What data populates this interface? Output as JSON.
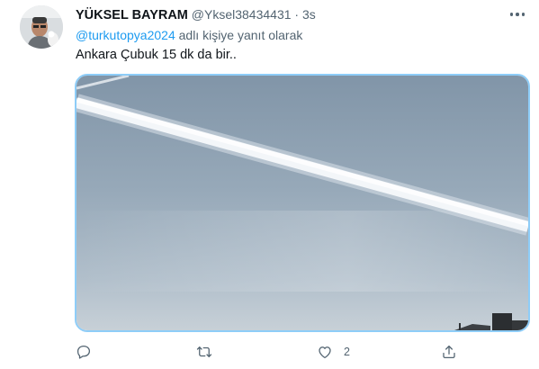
{
  "tweet": {
    "author_name": "YÜKSEL BAYRAM",
    "author_handle": "@Yksel38434431",
    "separator": "·",
    "time": "3s",
    "reply_to_handle": "@turkutopya2024",
    "reply_suffix": " adlı kişiye yanıt olarak",
    "text": "Ankara Çubuk 15 dk da bir..",
    "like_count": "2"
  },
  "icons": {
    "more": "more-horizontal-icon",
    "reply": "speech-bubble-icon",
    "retweet": "retweet-arrows-icon",
    "like": "heart-icon",
    "share": "share-upload-icon"
  },
  "colors": {
    "link": "#1d9bf0",
    "secondary_text": "#536471",
    "media_border": "#8ecdf8"
  }
}
